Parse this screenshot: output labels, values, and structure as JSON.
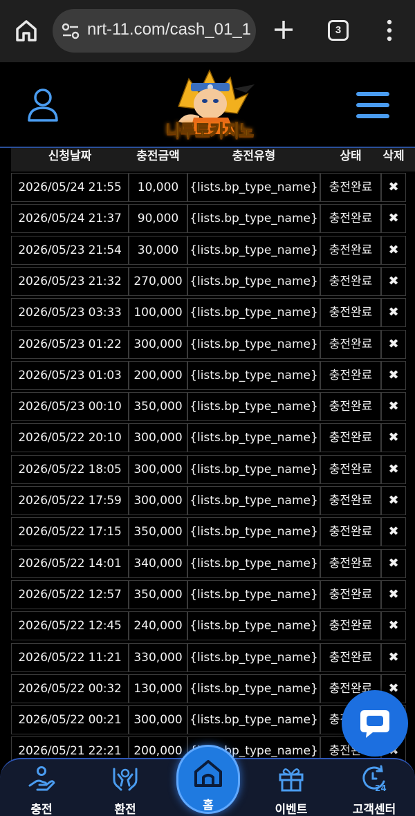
{
  "browser": {
    "url": "nrt-11.com/cash_01_1",
    "tab_count": "3"
  },
  "header": {
    "logo_text": "나루토카지노"
  },
  "table": {
    "columns": [
      "신청날짜",
      "충전금액",
      "충전유형",
      "상태",
      "삭제"
    ],
    "rows": [
      {
        "date": "2026/05/24 21:55",
        "amount": "10,000",
        "type": "{lists.bp_type_name}",
        "status": "충전완료",
        "delete": "✖"
      },
      {
        "date": "2026/05/24 21:37",
        "amount": "90,000",
        "type": "{lists.bp_type_name}",
        "status": "충전완료",
        "delete": "✖"
      },
      {
        "date": "2026/05/23 21:54",
        "amount": "30,000",
        "type": "{lists.bp_type_name}",
        "status": "충전완료",
        "delete": "✖"
      },
      {
        "date": "2026/05/23 21:32",
        "amount": "270,000",
        "type": "{lists.bp_type_name}",
        "status": "충전완료",
        "delete": "✖"
      },
      {
        "date": "2026/05/23 03:33",
        "amount": "100,000",
        "type": "{lists.bp_type_name}",
        "status": "충전완료",
        "delete": "✖"
      },
      {
        "date": "2026/05/23 01:22",
        "amount": "300,000",
        "type": "{lists.bp_type_name}",
        "status": "충전완료",
        "delete": "✖"
      },
      {
        "date": "2026/05/23 01:03",
        "amount": "200,000",
        "type": "{lists.bp_type_name}",
        "status": "충전완료",
        "delete": "✖"
      },
      {
        "date": "2026/05/23 00:10",
        "amount": "350,000",
        "type": "{lists.bp_type_name}",
        "status": "충전완료",
        "delete": "✖"
      },
      {
        "date": "2026/05/22 20:10",
        "amount": "300,000",
        "type": "{lists.bp_type_name}",
        "status": "충전완료",
        "delete": "✖"
      },
      {
        "date": "2026/05/22 18:05",
        "amount": "300,000",
        "type": "{lists.bp_type_name}",
        "status": "충전완료",
        "delete": "✖"
      },
      {
        "date": "2026/05/22 17:59",
        "amount": "300,000",
        "type": "{lists.bp_type_name}",
        "status": "충전완료",
        "delete": "✖"
      },
      {
        "date": "2026/05/22 17:15",
        "amount": "350,000",
        "type": "{lists.bp_type_name}",
        "status": "충전완료",
        "delete": "✖"
      },
      {
        "date": "2026/05/22 14:01",
        "amount": "340,000",
        "type": "{lists.bp_type_name}",
        "status": "충전완료",
        "delete": "✖"
      },
      {
        "date": "2026/05/22 12:57",
        "amount": "350,000",
        "type": "{lists.bp_type_name}",
        "status": "충전완료",
        "delete": "✖"
      },
      {
        "date": "2026/05/22 12:45",
        "amount": "240,000",
        "type": "{lists.bp_type_name}",
        "status": "충전완료",
        "delete": "✖"
      },
      {
        "date": "2026/05/22 11:21",
        "amount": "330,000",
        "type": "{lists.bp_type_name}",
        "status": "충전완료",
        "delete": "✖"
      },
      {
        "date": "2026/05/22 00:32",
        "amount": "130,000",
        "type": "{lists.bp_type_name}",
        "status": "충전완료",
        "delete": "✖"
      },
      {
        "date": "2026/05/22 00:21",
        "amount": "300,000",
        "type": "{lists.bp_type_name}",
        "status": "충전완료",
        "delete": "✖"
      },
      {
        "date": "2026/05/21 22:21",
        "amount": "200,000",
        "type": "{lists.bp_type_name}",
        "status": "충전완료",
        "delete": "✖"
      }
    ]
  },
  "bottom_nav": {
    "items": [
      {
        "label": "충전",
        "icon": "hand-coin-icon"
      },
      {
        "label": "환전",
        "icon": "hands-exchange-icon"
      },
      {
        "label": "홈",
        "icon": "home-icon"
      },
      {
        "label": "이벤트",
        "icon": "gift-icon"
      },
      {
        "label": "고객센터",
        "icon": "support-24-icon"
      }
    ]
  },
  "colors": {
    "accent": "#1f7ae0",
    "icon_blue": "#4a9cf0",
    "nav_bg": "#121a2e"
  }
}
